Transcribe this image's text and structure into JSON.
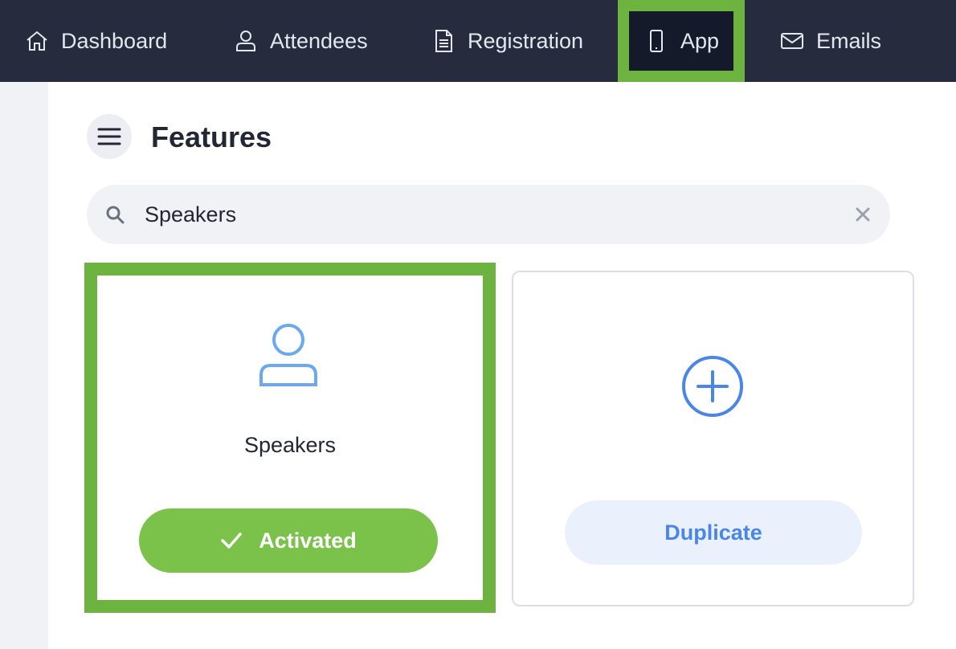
{
  "nav": {
    "items": [
      {
        "label": "Dashboard",
        "icon": "home-icon"
      },
      {
        "label": "Attendees",
        "icon": "user-icon"
      },
      {
        "label": "Registration",
        "icon": "document-icon"
      },
      {
        "label": "App",
        "icon": "phone-icon",
        "active": true
      },
      {
        "label": "Emails",
        "icon": "mail-icon"
      }
    ]
  },
  "page": {
    "title": "Features"
  },
  "search": {
    "value": "Speakers",
    "placeholder": ""
  },
  "cards": {
    "speakers": {
      "label": "Speakers",
      "button_label": "Activated",
      "icon": "user-icon"
    },
    "duplicate": {
      "button_label": "Duplicate",
      "icon": "plus-circle-icon"
    }
  },
  "colors": {
    "nav_bg": "#262c3d",
    "highlight": "#6db33f",
    "activated_bg": "#7bc24a",
    "accent_blue": "#4a86e8",
    "duplicate_bg": "#eaf1fd"
  }
}
